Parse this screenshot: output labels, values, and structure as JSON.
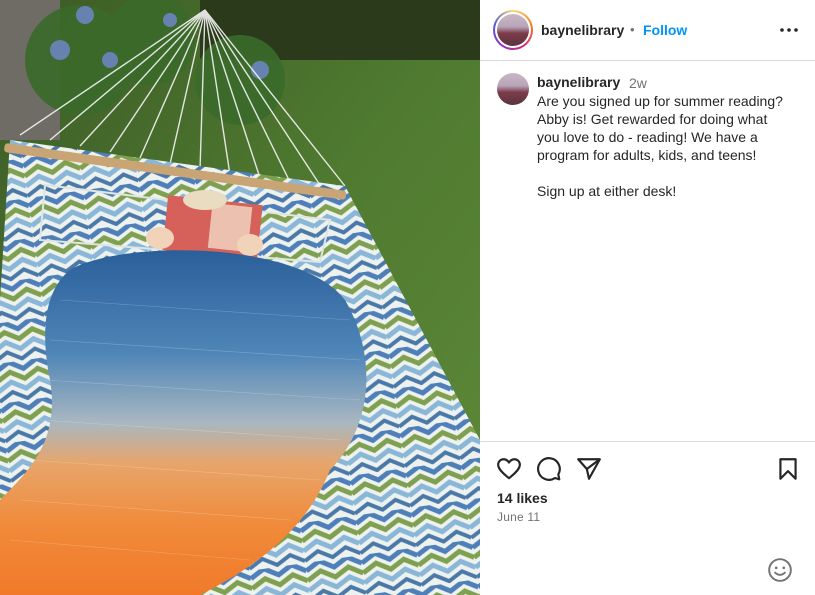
{
  "post": {
    "username": "baynelibrary",
    "separator": "•",
    "follow_label": "Follow",
    "time_ago": "2w",
    "caption_lines": [
      "Are you signed up for summer reading?",
      "Abby is! Get rewarded for doing what",
      "you love to do - reading! We have a",
      "program for adults, kids, and teens!",
      "",
      "Sign up at either desk!"
    ],
    "likes": "14 likes",
    "date": "June 11"
  },
  "icons": {
    "more": "more-options-icon",
    "like": "heart-icon",
    "comment": "comment-icon",
    "share": "send-icon",
    "save": "bookmark-icon",
    "emoji": "emoji-icon"
  },
  "colors": {
    "link_blue": "#0095f6",
    "text": "#262626",
    "muted": "#737373",
    "border": "#dbdbdb"
  }
}
